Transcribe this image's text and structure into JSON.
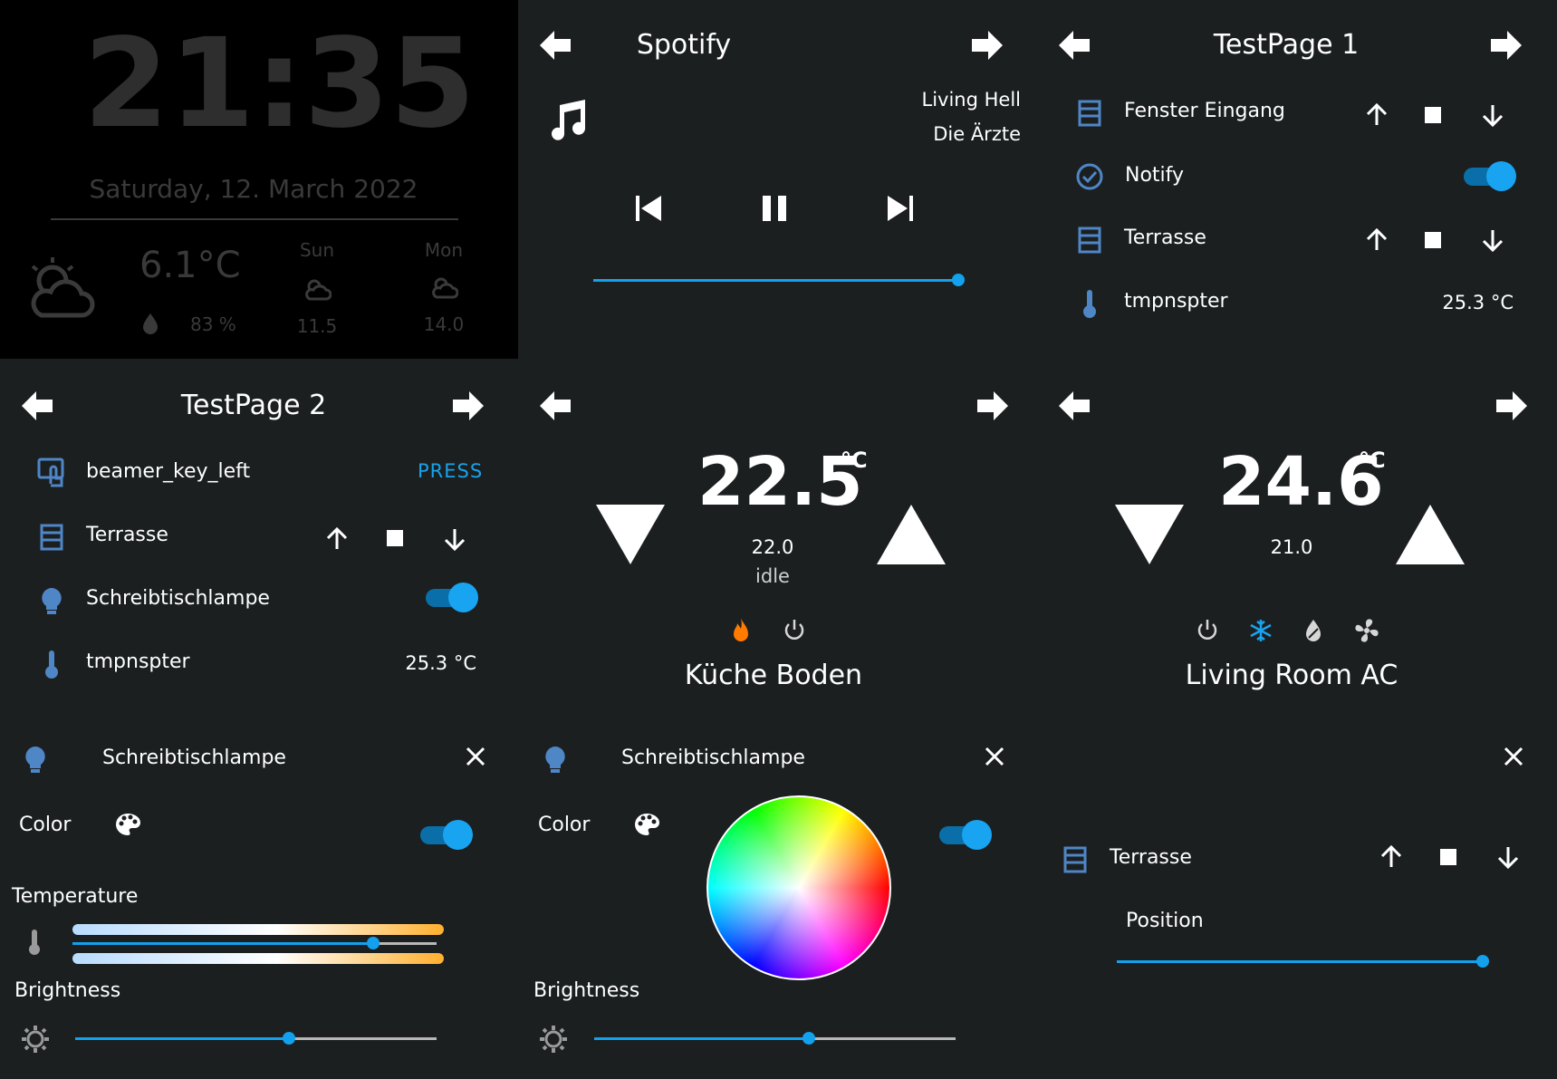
{
  "clock": {
    "time": "21:35",
    "date": "Saturday, 12. March 2022",
    "temperature": "6.1°C",
    "humidity": "83 %",
    "forecast": [
      {
        "day": "Sun",
        "temp": "11.5"
      },
      {
        "day": "Mon",
        "temp": "14.0"
      }
    ]
  },
  "spotify": {
    "title": "Spotify",
    "track": "Living Hell",
    "artist": "Die Ärzte",
    "progress": 1.0
  },
  "page1": {
    "title": "TestPage 1",
    "rows": [
      {
        "label": "Fenster Eingang"
      },
      {
        "label": "Notify"
      },
      {
        "label": "Terrasse"
      },
      {
        "label": "tmpnspter",
        "value": "25.3 °C"
      }
    ]
  },
  "page2": {
    "title": "TestPage 2",
    "rows": [
      {
        "label": "beamer_key_left",
        "action": "PRESS"
      },
      {
        "label": "Terrasse"
      },
      {
        "label": "Schreibtischlampe"
      },
      {
        "label": "tmpnspter",
        "value": "25.3 °C"
      }
    ]
  },
  "thermo1": {
    "current": "22.5",
    "unit": "°C",
    "target": "22.0",
    "status": "idle",
    "name": "Küche Boden"
  },
  "thermo2": {
    "current": "24.6",
    "unit": "°C",
    "target": "21.0",
    "name": "Living Room AC"
  },
  "light1": {
    "name": "Schreibtischlampe",
    "color_label": "Color",
    "temperature_label": "Temperature",
    "brightness_label": "Brightness",
    "temperature_level": 0.82,
    "brightness_level": 0.6
  },
  "light2": {
    "name": "Schreibtischlampe",
    "color_label": "Color",
    "brightness_label": "Brightness",
    "brightness_level": 0.6
  },
  "cover": {
    "name": "Terrasse",
    "position_label": "Position",
    "position": 1.0
  },
  "colors": {
    "background": "#1b1f20",
    "accent": "#13a0ec",
    "icon_blue": "#4f86c6",
    "heat": "#ff7a00"
  }
}
